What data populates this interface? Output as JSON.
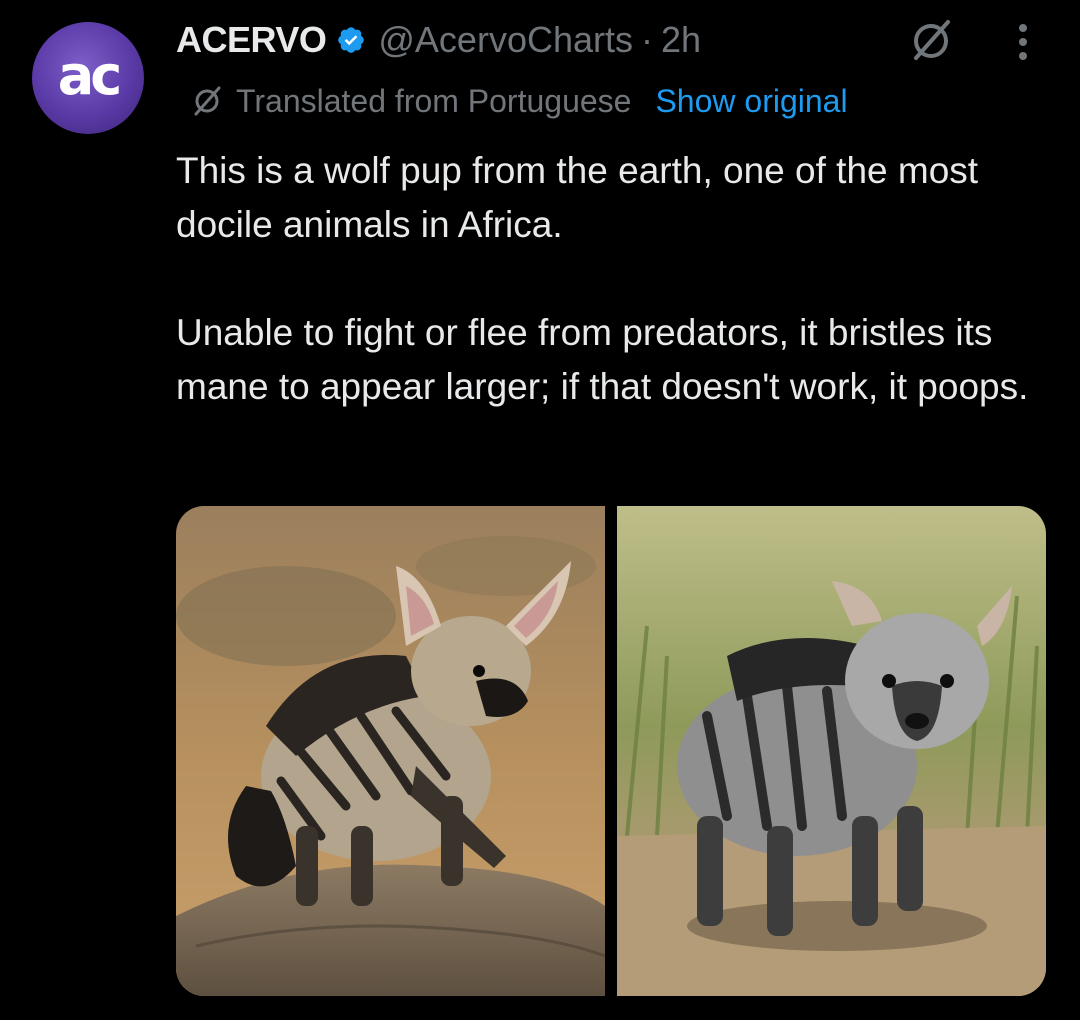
{
  "author": {
    "avatar_text": "ac",
    "name": "ACERVO",
    "verified": true,
    "handle": "@AcervoCharts",
    "separator": "·",
    "time": "2h"
  },
  "translation": {
    "label": "Translated from Portuguese",
    "show_original": "Show original"
  },
  "tweet": {
    "paragraphs": [
      "This is a wolf pup from the earth, one of the most docile animals in Africa.",
      "Unable to fight or flee from predators, it bristles its mane to appear larger; if that doesn't work, it poops."
    ]
  },
  "media": {
    "images": [
      {
        "depicts": "aardwolf pup with large ears and striped fur standing on a rock"
      },
      {
        "depicts": "grey striped aardwolf pup standing on sandy ground with grass"
      }
    ]
  },
  "icons": {
    "verified": "verified-badge-icon",
    "grok": "grok-icon",
    "more": "more-vertical-icon",
    "translate": "translate-icon"
  },
  "colors": {
    "background": "#000000",
    "text": "#e7e9ea",
    "muted": "#71767b",
    "link": "#1d9bf0",
    "avatar": "#5a3aa6"
  }
}
